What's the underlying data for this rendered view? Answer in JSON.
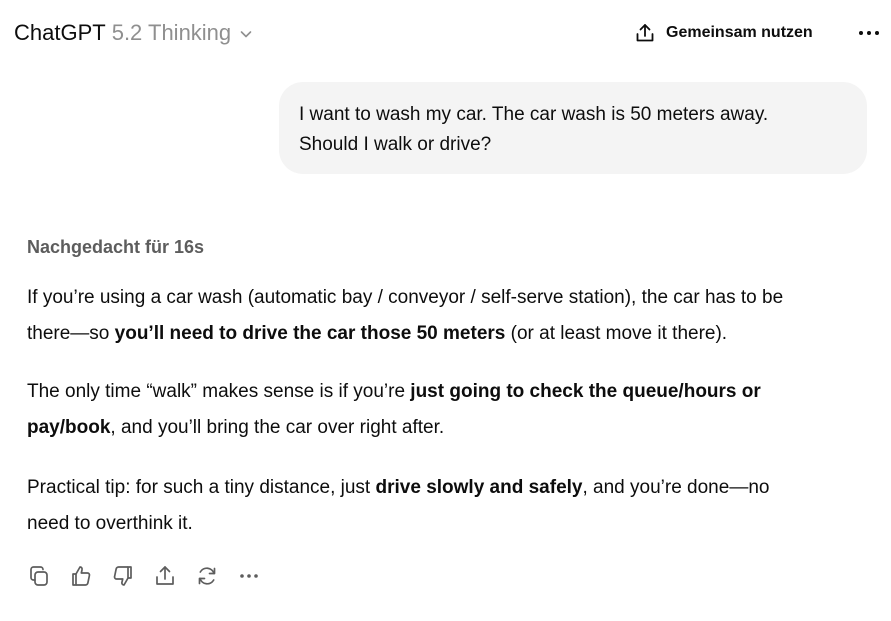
{
  "header": {
    "brand": "ChatGPT",
    "model_version": "5.2 Thinking",
    "share_label": "Gemeinsam nutzen"
  },
  "conversation": {
    "user_message": {
      "line1": "I want to wash my car. The car wash is 50 meters away.",
      "line2": "Should I walk or drive?"
    },
    "assistant": {
      "thought_label": "Nachgedacht für 16s",
      "p1": {
        "l1": "If you’re using a car wash (automatic bay / conveyor / self-serve station), the car has to be",
        "l2a": "there—so ",
        "l2b": "you’ll need to drive the car those 50 meters",
        "l2c": " (or at least move it there)."
      },
      "p2": {
        "l1a": "The only time “walk” makes sense is if you’re ",
        "l1b": "just going to check the queue/hours or",
        "l2a": "pay/book",
        "l2b": ", and you’ll bring the car over right after."
      },
      "p3": {
        "l1a": "Practical tip: for such a tiny distance, just ",
        "l1b": "drive slowly and safely",
        "l1c": ", and you’re done—no",
        "l2": "need to overthink it."
      }
    }
  },
  "icons": {
    "header": [
      "chevron-down-icon",
      "share-icon",
      "more-icon"
    ],
    "actions": [
      "copy-icon",
      "thumbs-up-icon",
      "thumbs-down-icon",
      "share-icon",
      "regenerate-icon",
      "more-icon"
    ]
  },
  "colors": {
    "text": "#0d0d0d",
    "muted": "#8f8f8f",
    "thought": "#5d5d5d",
    "bubble": "#f4f4f4",
    "icon": "#5d5d5d"
  }
}
